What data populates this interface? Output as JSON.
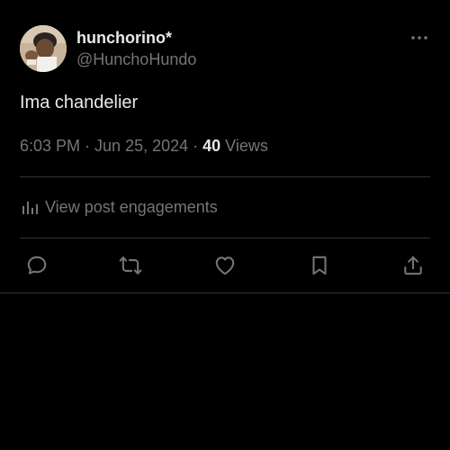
{
  "post": {
    "author": {
      "display_name": "hunchorino*",
      "handle": "@HunchoHundo",
      "avatar_icon": "avatar-photo"
    },
    "text": "Ima chandelier",
    "meta": {
      "time": "6:03 PM",
      "separator1": " · ",
      "date": "Jun 25, 2024",
      "separator2": " · ",
      "views_count": "40",
      "views_label": " Views"
    },
    "engagements_label": "View post engagements",
    "actions": [
      {
        "name": "reply",
        "icon": "reply-icon"
      },
      {
        "name": "repost",
        "icon": "repost-icon"
      },
      {
        "name": "like",
        "icon": "heart-icon"
      },
      {
        "name": "bookmark",
        "icon": "bookmark-icon"
      },
      {
        "name": "share",
        "icon": "share-icon"
      }
    ]
  },
  "colors": {
    "background": "#000000",
    "primary_text": "#e7e9ea",
    "secondary_text": "#71767b",
    "divider": "#2f3336"
  }
}
